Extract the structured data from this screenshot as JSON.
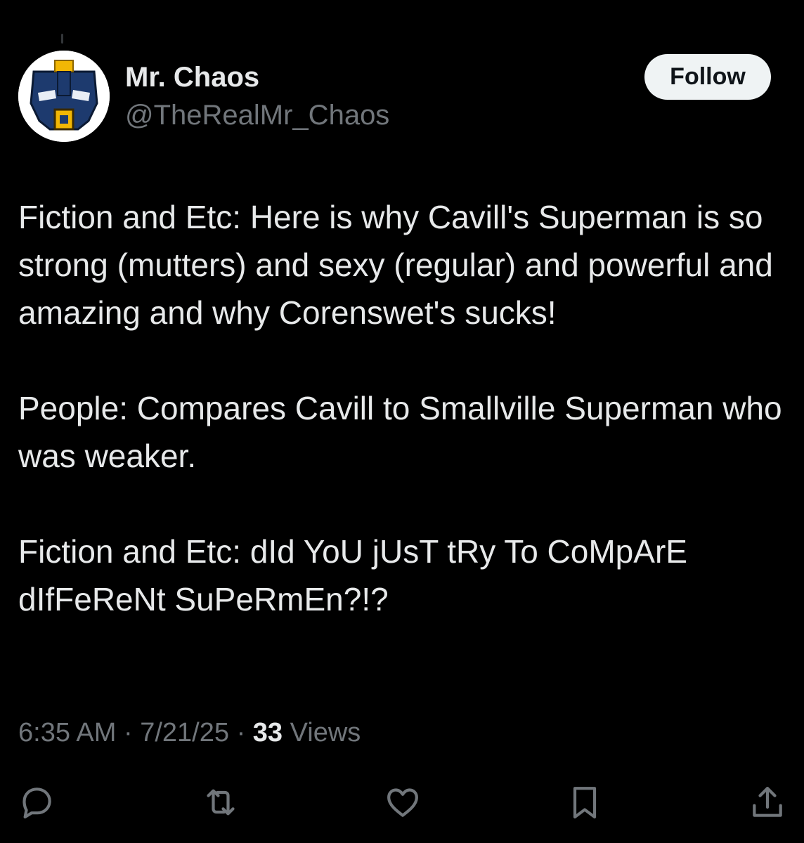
{
  "author": {
    "display_name": "Mr. Chaos",
    "handle": "@TheRealMr_Chaos",
    "avatar_icon": "robot-mask-avatar"
  },
  "follow_button": {
    "label": "Follow"
  },
  "tweet": {
    "paragraphs": [
      "Fiction and Etc: Here is why Cavill's Superman is so strong (mutters) and sexy (regular) and powerful and amazing and why Corenswet's sucks!",
      "People: Compares Cavill to Smallville Superman who was weaker.",
      "Fiction and Etc: dId YoU jUsT tRy To CoMpArE dIfFeReNt SuPeRmEn?!?"
    ]
  },
  "meta": {
    "time": "6:35 AM",
    "separator": "·",
    "date": "7/21/25",
    "views_count": "33",
    "views_label": "Views"
  },
  "actions": [
    {
      "name": "reply",
      "icon": "reply-icon"
    },
    {
      "name": "repost",
      "icon": "repost-icon"
    },
    {
      "name": "like",
      "icon": "like-icon"
    },
    {
      "name": "bookmark",
      "icon": "bookmark-icon"
    },
    {
      "name": "share",
      "icon": "share-icon"
    }
  ],
  "colors": {
    "background": "#000000",
    "primary_text": "#e7e9ea",
    "secondary_text": "#71767b",
    "follow_bg": "#eff3f4",
    "avatar_blue": "#1d3a6e",
    "avatar_gold": "#f2b705"
  }
}
